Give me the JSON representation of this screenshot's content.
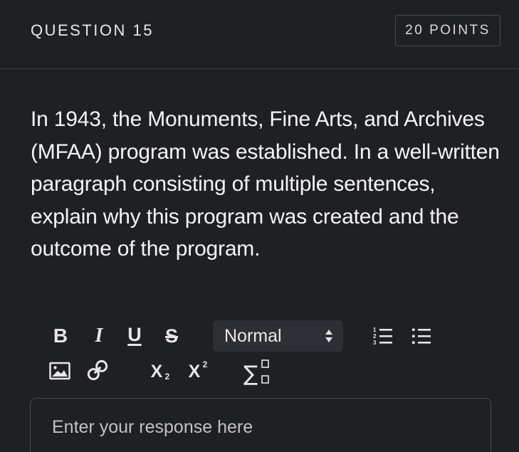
{
  "header": {
    "question_label": "QUESTION 15",
    "points_label": "20 POINTS"
  },
  "question": {
    "text": "In 1943, the Monuments, Fine Arts, and Archives (MFAA) program was established. In a well-written paragraph consisting of multiple sentences, explain why this program was created and the outcome of the program."
  },
  "toolbar": {
    "bold_label": "B",
    "italic_label": "I",
    "underline_label": "U",
    "strike_label": "S",
    "format_select_value": "Normal",
    "subscript_base": "X",
    "subscript_mark": "2",
    "superscript_base": "X",
    "superscript_mark": "2",
    "icons": [
      "ordered-list-icon",
      "bullet-list-icon",
      "image-icon",
      "link-icon",
      "formula-icon",
      "select-arrows-icon"
    ]
  },
  "response": {
    "placeholder": "Enter your response here",
    "value": ""
  },
  "colors": {
    "background": "#1f2024",
    "text": "#f4f4f5",
    "border": "#48494f",
    "select_bg": "#2e2f34"
  }
}
